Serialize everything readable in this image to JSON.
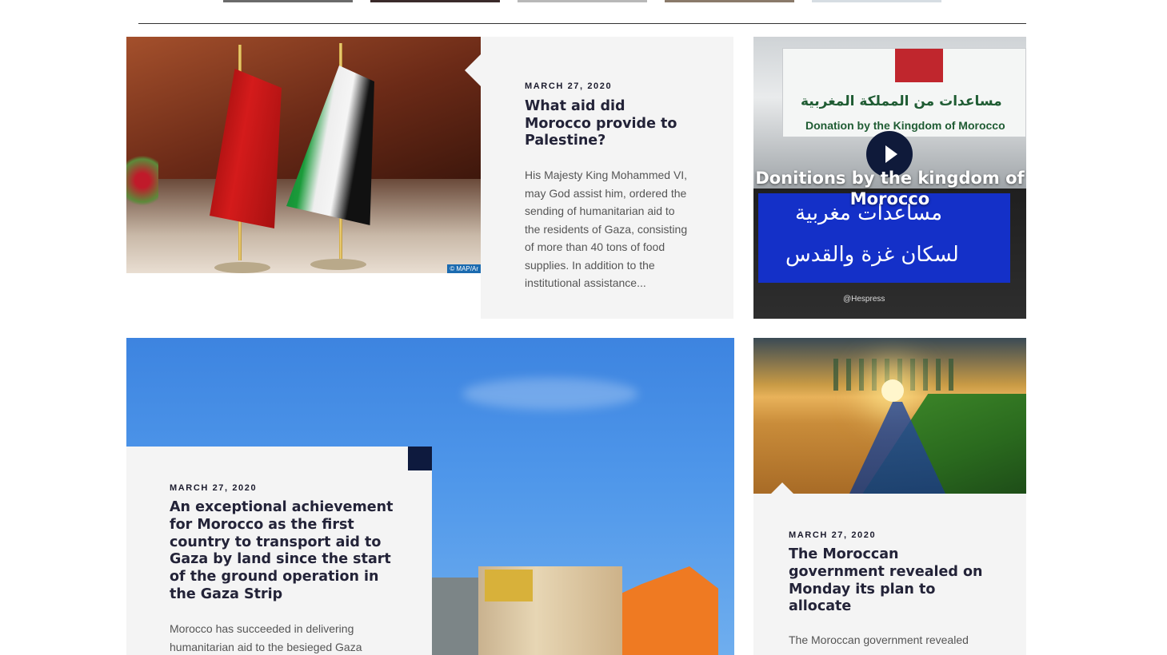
{
  "top_strip": {
    "thumbnails": [
      {
        "color": "#6b6b6b"
      },
      {
        "color": "#3a2a2a"
      },
      {
        "color": "#b8b8b8"
      },
      {
        "color": "#8a7a6a"
      },
      {
        "color": "#d6dde3"
      }
    ]
  },
  "articles": [
    {
      "date": "MARCH 27, 2020",
      "title": "What aid did Morocco provide to Palestine?",
      "excerpt": "His Majesty King Mohammed VI, may God assist him, ordered the sending of humanitarian aid to the residents of Gaza, consisting of more than 40 tons of food supplies. In addition to the institutional assistance...",
      "image_credit": "© MAP/Ar"
    },
    {
      "date": "MARCH 27, 2020",
      "title": "An exceptional achievement for Morocco as the first country to transport aid to Gaza by land since the start of the ground operation in the Gaza Strip",
      "excerpt": "Morocco has succeeded in delivering humanitarian aid to the besieged Gaza"
    },
    {
      "date": "MARCH 27, 2020",
      "title": "The Moroccan government revealed on Monday its plan to allocate",
      "excerpt": "The Moroccan government revealed"
    }
  ],
  "video": {
    "title": "Donitions by the kingdom of Morocco",
    "sign_arabic": "مساعدات من المملكة المغربية",
    "sign_english": "Donation by the Kingdom of Morocco",
    "overlay_arabic_1": "مساعدات مغربية",
    "overlay_arabic_2": "لسكان غزة والقدس",
    "social_handle": "@Hespress",
    "play_icon": "play-icon"
  },
  "colors": {
    "navy": "#0e1a3e",
    "panel": "#f4f4f4"
  }
}
